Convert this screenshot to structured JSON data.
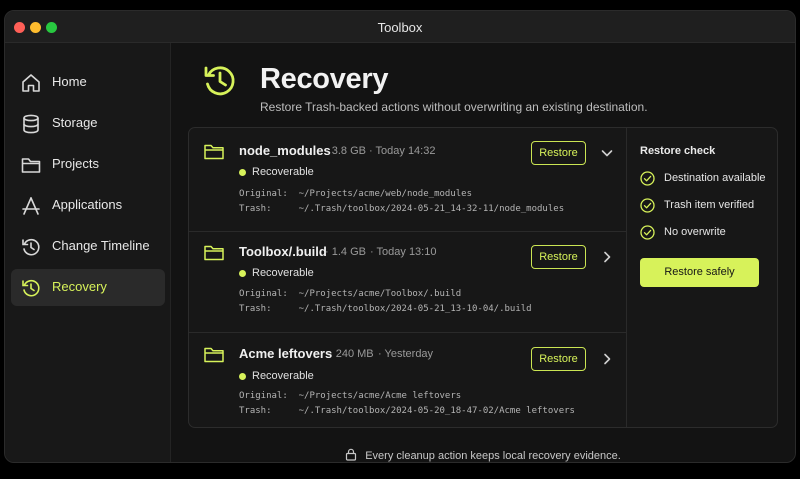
{
  "window": {
    "title": "Toolbox"
  },
  "sidebar": {
    "items": [
      {
        "label": "Home",
        "icon": "home-icon"
      },
      {
        "label": "Storage",
        "icon": "database-icon"
      },
      {
        "label": "Projects",
        "icon": "folder-icon"
      },
      {
        "label": "Applications",
        "icon": "applications-icon"
      },
      {
        "label": "Change Timeline",
        "icon": "history-icon"
      },
      {
        "label": "Recovery",
        "icon": "recovery-icon",
        "active": true
      }
    ]
  },
  "page": {
    "title": "Recovery",
    "subtitle": "Restore Trash-backed actions without overwriting an existing destination."
  },
  "items": [
    {
      "name": "node_modules",
      "size": "3.8 GB",
      "time": "Today 14:32",
      "status": "Recoverable",
      "original": "Original:  ~/Projects/acme/web/node_modules",
      "trash": "Trash:     ~/.Trash/toolbox/2024-05-21_14-32-11/node_modules",
      "button": "Restore",
      "expanded": true
    },
    {
      "name": "Toolbox/.build",
      "size": "1.4 GB",
      "time": "Today 13:10",
      "status": "Recoverable",
      "original": "Original:  ~/Projects/acme/Toolbox/.build",
      "trash": "Trash:     ~/.Trash/toolbox/2024-05-21_13-10-04/.build",
      "button": "Restore",
      "expanded": false
    },
    {
      "name": "Acme leftovers",
      "size": "240 MB",
      "time": "Yesterday",
      "status": "Recoverable",
      "original": "Original:  ~/Projects/acme/Acme leftovers",
      "trash": "Trash:     ~/.Trash/toolbox/2024-05-20_18-47-02/Acme leftovers",
      "button": "Restore",
      "expanded": false
    }
  ],
  "restore_check": {
    "title": "Restore check",
    "checks": [
      "Destination available",
      "Trash item verified",
      "No overwrite"
    ],
    "button": "Restore safely"
  },
  "footer": {
    "text": "Every cleanup action keeps local recovery evidence."
  },
  "colors": {
    "accent": "#d7f25a",
    "background": "#131313",
    "sidebar": "#181818"
  }
}
